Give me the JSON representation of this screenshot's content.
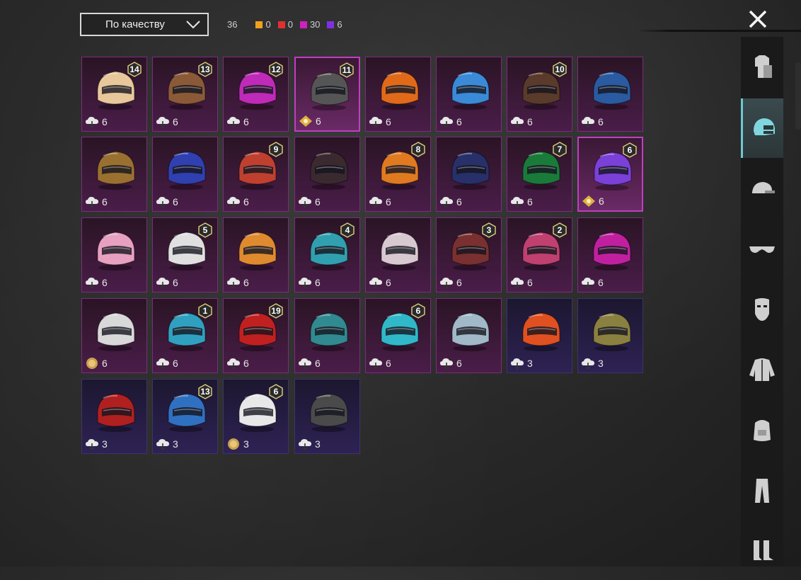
{
  "sort": {
    "label": "По качеству"
  },
  "counts": {
    "total": "36",
    "rarities": [
      {
        "color": "#f0a020",
        "value": "0"
      },
      {
        "color": "#e03030",
        "value": "0"
      },
      {
        "color": "#d020c0",
        "value": "30"
      },
      {
        "color": "#8030e0",
        "value": "6"
      }
    ]
  },
  "sidebar": {
    "categories": [
      {
        "name": "outfit",
        "icon": "outfit-icon"
      },
      {
        "name": "helmet",
        "icon": "helmet-icon",
        "active": true
      },
      {
        "name": "hat",
        "icon": "cap-icon"
      },
      {
        "name": "glasses",
        "icon": "glasses-icon"
      },
      {
        "name": "mask",
        "icon": "mask-icon"
      },
      {
        "name": "jacket",
        "icon": "jacket-icon"
      },
      {
        "name": "backpack",
        "icon": "backpack-icon"
      },
      {
        "name": "pants",
        "icon": "pants-icon"
      },
      {
        "name": "shoes",
        "icon": "boots-icon"
      }
    ]
  },
  "items": [
    {
      "rarity": "legend",
      "level": "14",
      "currency": "cloud",
      "price": "6",
      "color": "#e8c79a"
    },
    {
      "rarity": "legend",
      "level": "13",
      "currency": "cloud",
      "price": "6",
      "color": "#8a5a38"
    },
    {
      "rarity": "legend",
      "level": "12",
      "currency": "cloud",
      "price": "6",
      "color": "#c02ab8"
    },
    {
      "rarity": "legend",
      "level": "11",
      "currency": "gold-diamond",
      "price": "6",
      "color": "#555555",
      "highlight": true
    },
    {
      "rarity": "legend",
      "level": "",
      "currency": "cloud",
      "price": "6",
      "color": "#e06a1a"
    },
    {
      "rarity": "legend",
      "level": "",
      "currency": "cloud",
      "price": "6",
      "color": "#3a8ad8"
    },
    {
      "rarity": "legend",
      "level": "10",
      "currency": "cloud",
      "price": "6",
      "color": "#5a3a2a"
    },
    {
      "rarity": "legend",
      "level": "",
      "currency": "cloud",
      "price": "6",
      "color": "#2a5aa0"
    },
    {
      "rarity": "legend",
      "level": "",
      "currency": "cloud",
      "price": "6",
      "color": "#9a7030"
    },
    {
      "rarity": "legend",
      "level": "",
      "currency": "cloud",
      "price": "6",
      "color": "#3040b0"
    },
    {
      "rarity": "legend",
      "level": "9",
      "currency": "cloud",
      "price": "6",
      "color": "#c04030"
    },
    {
      "rarity": "legend",
      "level": "",
      "currency": "cloud",
      "price": "6",
      "color": "#3a2a30"
    },
    {
      "rarity": "legend",
      "level": "8",
      "currency": "cloud",
      "price": "6",
      "color": "#e07a20"
    },
    {
      "rarity": "legend",
      "level": "",
      "currency": "cloud",
      "price": "6",
      "color": "#28306a"
    },
    {
      "rarity": "legend",
      "level": "7",
      "currency": "cloud",
      "price": "6",
      "color": "#1a7a3a"
    },
    {
      "rarity": "legend",
      "level": "6",
      "currency": "gold-diamond",
      "price": "6",
      "color": "#7a40d8",
      "highlight": true
    },
    {
      "rarity": "legend",
      "level": "",
      "currency": "cloud",
      "price": "6",
      "color": "#e8a0c0"
    },
    {
      "rarity": "legend",
      "level": "5",
      "currency": "cloud",
      "price": "6",
      "color": "#e0e0e0"
    },
    {
      "rarity": "legend",
      "level": "",
      "currency": "cloud",
      "price": "6",
      "color": "#e08a30"
    },
    {
      "rarity": "legend",
      "level": "4",
      "currency": "cloud",
      "price": "6",
      "color": "#30a0b0"
    },
    {
      "rarity": "legend",
      "level": "",
      "currency": "cloud",
      "price": "6",
      "color": "#d8c8d0"
    },
    {
      "rarity": "legend",
      "level": "3",
      "currency": "cloud",
      "price": "6",
      "color": "#7a3030"
    },
    {
      "rarity": "legend",
      "level": "2",
      "currency": "cloud",
      "price": "6",
      "color": "#c04070"
    },
    {
      "rarity": "legend",
      "level": "",
      "currency": "cloud",
      "price": "6",
      "color": "#c020a0"
    },
    {
      "rarity": "legend",
      "level": "",
      "currency": "coin",
      "price": "6",
      "color": "#d8d8d8"
    },
    {
      "rarity": "legend",
      "level": "1",
      "currency": "cloud",
      "price": "6",
      "color": "#30a0c0"
    },
    {
      "rarity": "legend",
      "level": "19",
      "currency": "cloud",
      "price": "6",
      "color": "#c02020"
    },
    {
      "rarity": "legend",
      "level": "",
      "currency": "cloud",
      "price": "6",
      "color": "#308a90"
    },
    {
      "rarity": "legend",
      "level": "6",
      "currency": "cloud",
      "price": "6",
      "color": "#30b8c8"
    },
    {
      "rarity": "legend",
      "level": "",
      "currency": "cloud",
      "price": "6",
      "color": "#a0b8c8"
    },
    {
      "rarity": "epic",
      "level": "",
      "currency": "cloud",
      "price": "3",
      "color": "#e05020"
    },
    {
      "rarity": "epic",
      "level": "",
      "currency": "cloud",
      "price": "3",
      "color": "#8a8040"
    },
    {
      "rarity": "epic",
      "level": "",
      "currency": "cloud",
      "price": "3",
      "color": "#b02020"
    },
    {
      "rarity": "epic",
      "level": "13",
      "currency": "cloud",
      "price": "3",
      "color": "#3070c0"
    },
    {
      "rarity": "epic",
      "level": "6",
      "currency": "coin",
      "price": "3",
      "color": "#e8e8e8"
    },
    {
      "rarity": "epic",
      "level": "",
      "currency": "cloud",
      "price": "3",
      "color": "#4a4a4a"
    }
  ]
}
